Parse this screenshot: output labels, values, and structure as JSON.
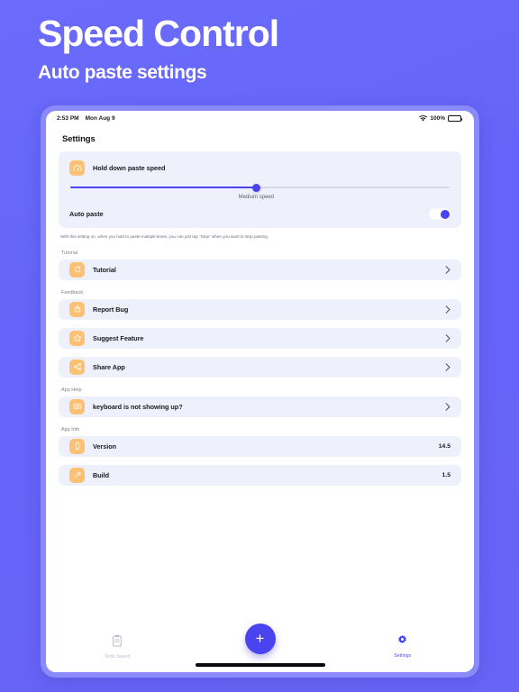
{
  "promo": {
    "title": "Speed Control",
    "subtitle": "Auto paste settings"
  },
  "statusbar": {
    "time": "2:53 PM",
    "date": "Mon Aug 9",
    "wifi_icon": "wifi-icon",
    "battery_percent": "100%",
    "battery_icon": "battery-full-icon"
  },
  "nav": {
    "title": "Settings"
  },
  "speed_card": {
    "icon": "speedometer-icon",
    "label": "Hold down paste speed",
    "slider": {
      "value_percent": 49,
      "caption": "Medium speed"
    },
    "toggle": {
      "label": "Auto paste",
      "state": "on"
    },
    "footnote": "With this setting on, when you hold to paste multiple times, you can just tap \"Stop\" when you want to stop pasting."
  },
  "sections": [
    {
      "label": "Tutorial",
      "rows": [
        {
          "icon": "replay-icon",
          "label": "Tutorial",
          "accessory": "chevron-right-icon",
          "value": ""
        }
      ]
    },
    {
      "label": "Feedback",
      "rows": [
        {
          "icon": "bug-icon",
          "label": "Report Bug",
          "accessory": "chevron-right-icon",
          "value": ""
        },
        {
          "icon": "star-icon",
          "label": "Suggest Feature",
          "accessory": "chevron-right-icon",
          "value": ""
        },
        {
          "icon": "share-icon",
          "label": "Share App",
          "accessory": "chevron-right-icon",
          "value": ""
        }
      ]
    },
    {
      "label": "App Help",
      "rows": [
        {
          "icon": "keyboard-icon",
          "label": "keyboard is not showing up?",
          "accessory": "chevron-right-icon",
          "value": ""
        }
      ]
    },
    {
      "label": "App Info",
      "rows": [
        {
          "icon": "info-icon",
          "label": "Version",
          "accessory": "value",
          "value": "14.5"
        },
        {
          "icon": "hammer-icon",
          "label": "Build",
          "accessory": "value",
          "value": "1.5"
        }
      ]
    }
  ],
  "tabbar": {
    "tabs": [
      {
        "icon": "clipboard-icon",
        "label": "Texts Saved",
        "active": false
      },
      {
        "icon": "gear-icon",
        "label": "Settings",
        "active": true
      }
    ],
    "fab": {
      "icon": "plus-icon",
      "label": "+"
    }
  },
  "colors": {
    "background": "#6464f8",
    "accent": "#4a43f0",
    "icon_tile": "#fcc173",
    "row_background": "#eef0fb"
  }
}
